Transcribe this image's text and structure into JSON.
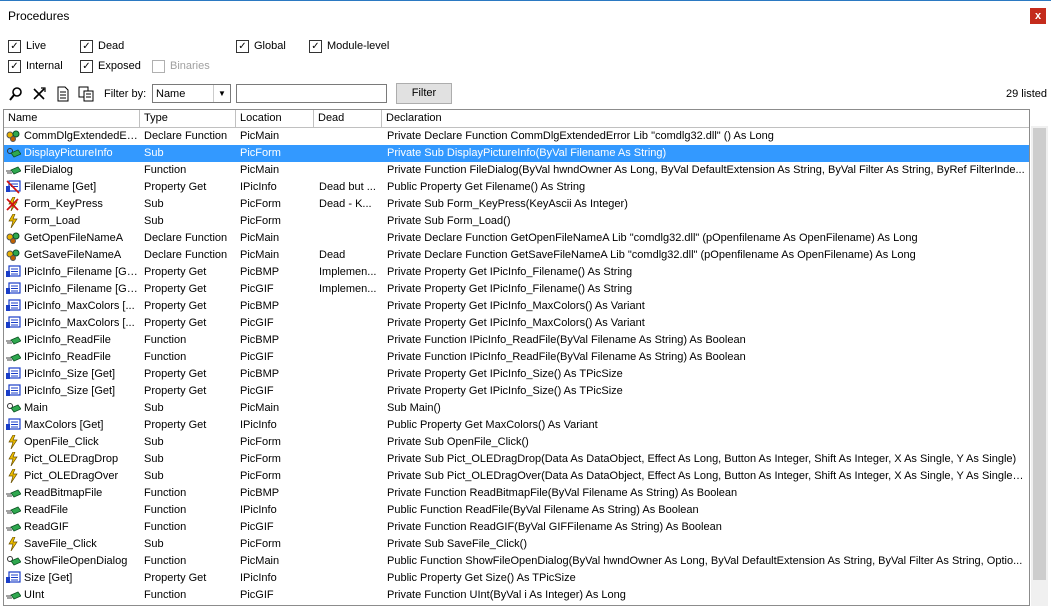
{
  "window": {
    "title": "Procedures",
    "close": "x"
  },
  "checkboxes": [
    {
      "label": "Live",
      "checked": true,
      "enabled": true
    },
    {
      "label": "Dead",
      "checked": true,
      "enabled": true
    },
    {
      "label": "Global",
      "checked": true,
      "enabled": true
    },
    {
      "label": "Module-level",
      "checked": true,
      "enabled": true
    },
    {
      "label": "Internal",
      "checked": true,
      "enabled": true
    },
    {
      "label": "Exposed",
      "checked": true,
      "enabled": true
    },
    {
      "label": "Binaries",
      "checked": false,
      "enabled": false
    }
  ],
  "toolbar": {
    "icons": [
      "find-icon",
      "cross-icon",
      "document-icon",
      "copy-icon"
    ],
    "filter_by_label": "Filter by:",
    "filter_field": "Name",
    "filter_text": "",
    "filter_button": "Filter",
    "count": "29 listed"
  },
  "columns": [
    "Name",
    "Type",
    "Location",
    "Dead",
    "Declaration"
  ],
  "rows": [
    {
      "icon": "declare",
      "name": "CommDlgExtendedEr...",
      "type": "Declare Function",
      "loc": "PicMain",
      "dead": "",
      "decl": "Private Declare Function CommDlgExtendedError Lib \"comdlg32.dll\" () As Long"
    },
    {
      "icon": "sub",
      "name": "DisplayPictureInfo",
      "type": "Sub",
      "loc": "PicForm",
      "dead": "",
      "decl": "Private Sub DisplayPictureInfo(ByVal Filename As String)",
      "selected": true
    },
    {
      "icon": "func",
      "name": "FileDialog",
      "type": "Function",
      "loc": "PicMain",
      "dead": "",
      "decl": "Private Function FileDialog(ByVal hwndOwner As Long, ByVal DefaultExtension As String, ByVal Filter As String, ByRef FilterInde..."
    },
    {
      "icon": "propdead",
      "name": "Filename [Get]",
      "type": "Property Get",
      "loc": "IPicInfo",
      "dead": "Dead but ...",
      "decl": "Public Property Get Filename() As String"
    },
    {
      "icon": "eventdead",
      "name": "Form_KeyPress",
      "type": "Sub",
      "loc": "PicForm",
      "dead": "Dead - K...",
      "decl": "Private Sub Form_KeyPress(KeyAscii As Integer)"
    },
    {
      "icon": "event",
      "name": "Form_Load",
      "type": "Sub",
      "loc": "PicForm",
      "dead": "",
      "decl": "Private Sub Form_Load()"
    },
    {
      "icon": "declare",
      "name": "GetOpenFileNameA",
      "type": "Declare Function",
      "loc": "PicMain",
      "dead": "",
      "decl": "Private Declare Function GetOpenFileNameA Lib \"comdlg32.dll\" (pOpenfilename As OpenFilename) As Long"
    },
    {
      "icon": "declare",
      "name": "GetSaveFileNameA",
      "type": "Declare Function",
      "loc": "PicMain",
      "dead": "Dead",
      "decl": "Private Declare Function GetSaveFileNameA Lib \"comdlg32.dll\" (pOpenfilename As OpenFilename) As Long"
    },
    {
      "icon": "prop",
      "name": "IPicInfo_Filename [Get]",
      "type": "Property Get",
      "loc": "PicBMP",
      "dead": "Implemen...",
      "decl": "Private Property Get IPicInfo_Filename() As String"
    },
    {
      "icon": "prop",
      "name": "IPicInfo_Filename [Get]",
      "type": "Property Get",
      "loc": "PicGIF",
      "dead": "Implemen...",
      "decl": "Private Property Get IPicInfo_Filename() As String"
    },
    {
      "icon": "prop",
      "name": "IPicInfo_MaxColors [...",
      "type": "Property Get",
      "loc": "PicBMP",
      "dead": "",
      "decl": "Private Property Get IPicInfo_MaxColors() As Variant"
    },
    {
      "icon": "prop",
      "name": "IPicInfo_MaxColors [...",
      "type": "Property Get",
      "loc": "PicGIF",
      "dead": "",
      "decl": "Private Property Get IPicInfo_MaxColors() As Variant"
    },
    {
      "icon": "func",
      "name": "IPicInfo_ReadFile",
      "type": "Function",
      "loc": "PicBMP",
      "dead": "",
      "decl": "Private Function IPicInfo_ReadFile(ByVal Filename As String) As Boolean"
    },
    {
      "icon": "func",
      "name": "IPicInfo_ReadFile",
      "type": "Function",
      "loc": "PicGIF",
      "dead": "",
      "decl": "Private Function IPicInfo_ReadFile(ByVal Filename As String) As Boolean"
    },
    {
      "icon": "prop",
      "name": "IPicInfo_Size [Get]",
      "type": "Property Get",
      "loc": "PicBMP",
      "dead": "",
      "decl": "Private Property Get IPicInfo_Size() As TPicSize"
    },
    {
      "icon": "prop",
      "name": "IPicInfo_Size [Get]",
      "type": "Property Get",
      "loc": "PicGIF",
      "dead": "",
      "decl": "Private Property Get IPicInfo_Size() As TPicSize"
    },
    {
      "icon": "sub",
      "name": "Main",
      "type": "Sub",
      "loc": "PicMain",
      "dead": "",
      "decl": "Sub Main()"
    },
    {
      "icon": "prop",
      "name": "MaxColors [Get]",
      "type": "Property Get",
      "loc": "IPicInfo",
      "dead": "",
      "decl": "Public Property Get MaxColors() As Variant"
    },
    {
      "icon": "event",
      "name": "OpenFile_Click",
      "type": "Sub",
      "loc": "PicForm",
      "dead": "",
      "decl": "Private Sub OpenFile_Click()"
    },
    {
      "icon": "event",
      "name": "Pict_OLEDragDrop",
      "type": "Sub",
      "loc": "PicForm",
      "dead": "",
      "decl": "Private Sub Pict_OLEDragDrop(Data As DataObject, Effect As Long, Button As Integer, Shift As Integer, X As Single, Y As Single)"
    },
    {
      "icon": "event",
      "name": "Pict_OLEDragOver",
      "type": "Sub",
      "loc": "PicForm",
      "dead": "",
      "decl": "Private Sub Pict_OLEDragOver(Data As DataObject, Effect As Long, Button As Integer, Shift As Integer, X As Single, Y As Single, ..."
    },
    {
      "icon": "func",
      "name": "ReadBitmapFile",
      "type": "Function",
      "loc": "PicBMP",
      "dead": "",
      "decl": "Private Function ReadBitmapFile(ByVal Filename As String) As Boolean"
    },
    {
      "icon": "func",
      "name": "ReadFile",
      "type": "Function",
      "loc": "IPicInfo",
      "dead": "",
      "decl": "Public Function ReadFile(ByVal Filename As String) As Boolean"
    },
    {
      "icon": "func",
      "name": "ReadGIF",
      "type": "Function",
      "loc": "PicGIF",
      "dead": "",
      "decl": "Private Function ReadGIF(ByVal GIFFilename As String) As Boolean"
    },
    {
      "icon": "event",
      "name": "SaveFile_Click",
      "type": "Sub",
      "loc": "PicForm",
      "dead": "",
      "decl": "Private Sub SaveFile_Click()"
    },
    {
      "icon": "sub",
      "name": "ShowFileOpenDialog",
      "type": "Function",
      "loc": "PicMain",
      "dead": "",
      "decl": "Public Function ShowFileOpenDialog(ByVal hwndOwner As Long, ByVal DefaultExtension As String, ByVal Filter As String, Optio..."
    },
    {
      "icon": "prop",
      "name": "Size [Get]",
      "type": "Property Get",
      "loc": "IPicInfo",
      "dead": "",
      "decl": "Public Property Get Size() As TPicSize"
    },
    {
      "icon": "func",
      "name": "UInt",
      "type": "Function",
      "loc": "PicGIF",
      "dead": "",
      "decl": "Private Function UInt(ByVal i As Integer) As Long"
    }
  ],
  "colors": {
    "selection": "#3399ff",
    "close": "#c42b1c",
    "method_green": "#2fa84f",
    "prop_blue": "#1a3ec8",
    "dead_red": "#d01010",
    "event_yellow": "#f0c000"
  }
}
